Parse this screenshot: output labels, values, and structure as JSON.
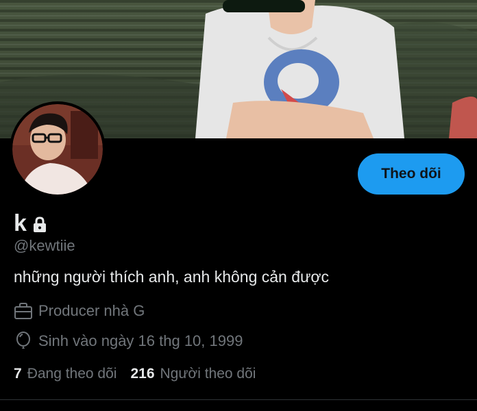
{
  "profile": {
    "display_name": "k",
    "handle": "@kewtiie",
    "bio": "những người thích anh, anh không cản được",
    "job": "Producer nhà G",
    "birthday": "Sinh vào ngày 16 thg 10, 1999",
    "protected": true
  },
  "actions": {
    "follow_label": "Theo dõi"
  },
  "stats": {
    "following_count": "7",
    "following_label": "Đang theo dõi",
    "followers_count": "216",
    "followers_label": "Người theo dõi"
  },
  "icons": {
    "lock": "lock-icon",
    "job": "briefcase-icon",
    "birthday": "balloon-icon"
  },
  "colors": {
    "background": "#000000",
    "accent": "#1d9bf0",
    "text_primary": "#e7e9ea",
    "text_secondary": "#71767b"
  }
}
